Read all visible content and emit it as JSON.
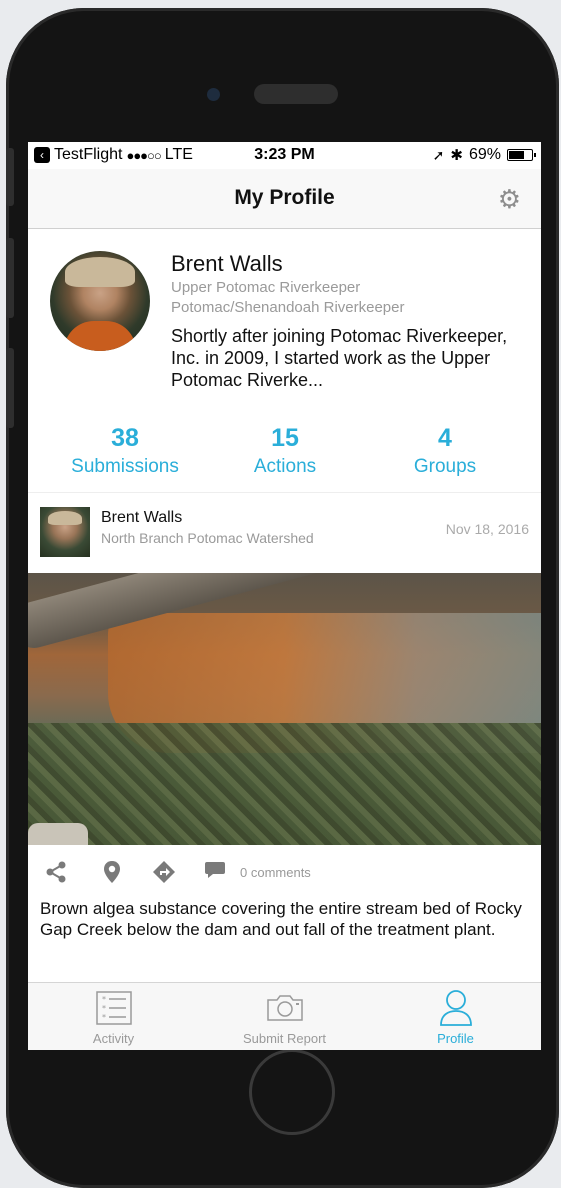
{
  "status_bar": {
    "carrier_app": "TestFlight",
    "signal": "●●●○○",
    "network": "LTE",
    "time": "3:23 PM",
    "battery_percent": "69%",
    "battery_level": 0.69
  },
  "nav": {
    "title": "My Profile",
    "settings_icon": "gear-icon"
  },
  "profile": {
    "name": "Brent Walls",
    "organization_1": "Upper Potomac Riverkeeper",
    "organization_2": "Potomac/Shenandoah Riverkeeper",
    "bio": "Shortly after joining Potomac Riverkeeper, Inc. in 2009, I started work as the Upper Potomac Riverke..."
  },
  "stats": [
    {
      "value": "38",
      "label": "Submissions"
    },
    {
      "value": "15",
      "label": "Actions"
    },
    {
      "value": "4",
      "label": "Groups"
    }
  ],
  "post": {
    "author": "Brent Walls",
    "location": "North Branch Potomac Watershed",
    "date": "Nov 18, 2016",
    "comments": "0 comments",
    "caption": "Brown algea substance covering the entire stream bed of Rocky Gap Creek below the dam and out fall of the treatment plant."
  },
  "tabs": [
    {
      "label": "Activity",
      "icon": "list-icon",
      "active": false
    },
    {
      "label": "Submit Report",
      "icon": "camera-icon",
      "active": false
    },
    {
      "label": "Profile",
      "icon": "person-icon",
      "active": true
    }
  ],
  "colors": {
    "accent": "#2aaed9",
    "secondary_text": "#9a9a9a"
  }
}
